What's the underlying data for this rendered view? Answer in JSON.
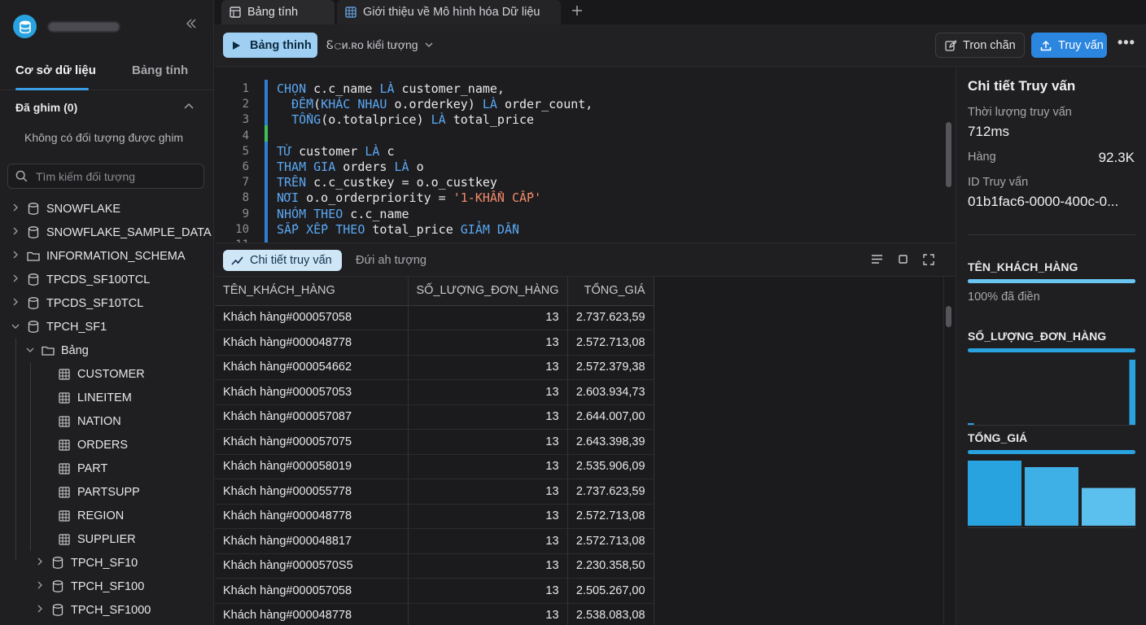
{
  "sidebar": {
    "tabs": [
      "Cơ sở dữ liệu",
      "Bảng tính"
    ],
    "pinned_title": "Đã ghim (0)",
    "no_pinned": "Không có đối tượng được ghim",
    "search_placeholder": "Tìm kiếm đối tượng",
    "databases": [
      "SNOWFLAKE",
      "SNOWFLAKE_SAMPLE_DATA",
      "INFORMATION_SCHEMA",
      "TPCDS_SF100TCL",
      "TPCDS_SF10TCL",
      "TPCH_SF1"
    ],
    "folder": "Bảng",
    "tables": [
      "CUSTOMER",
      "LINEITEM",
      "NATION",
      "ORDERS",
      "PART",
      "PARTSUPP",
      "REGION",
      "SUPPLIER"
    ],
    "schemas": [
      "TPCH_SF10",
      "TPCH_SF100",
      "TPCH_SF1000"
    ]
  },
  "tabs": [
    "Bảng tính",
    "Giới thiệu về Mô hình hóa Dữ liệu"
  ],
  "toolbar": {
    "run_label": "Bảng thinh",
    "context_label": "Ꮛ𝚌ᴎ.ʀo kiểi tượng",
    "format_label": "Tron chãn",
    "query_label": "Truy vấn",
    "more_label": "•••"
  },
  "editor": {
    "line_numbers": [
      "1",
      "2",
      "3",
      "4",
      "5",
      "6",
      "7",
      "8",
      "9",
      "10",
      "11"
    ],
    "lines": [
      [
        {
          "t": "CHỌN",
          "k": "kw"
        },
        {
          "t": " c.c_name "
        },
        {
          "t": "LÀ",
          "k": "kw"
        },
        {
          "t": " customer_name,"
        }
      ],
      [
        {
          "t": "  "
        },
        {
          "t": "ĐẾM",
          "k": "kw"
        },
        {
          "t": "("
        },
        {
          "t": "KHÁC NHAU",
          "k": "kw"
        },
        {
          "t": " o.orderkey) "
        },
        {
          "t": "LÀ",
          "k": "kw"
        },
        {
          "t": " order_count,"
        }
      ],
      [
        {
          "t": "  "
        },
        {
          "t": "TỔNG",
          "k": "kw"
        },
        {
          "t": "(o.totalprice) "
        },
        {
          "t": "LÀ",
          "k": "kw"
        },
        {
          "t": " total_price"
        }
      ],
      [
        {
          "t": ""
        }
      ],
      [
        {
          "t": "TỪ",
          "k": "kw"
        },
        {
          "t": " customer "
        },
        {
          "t": "LÀ",
          "k": "kw"
        },
        {
          "t": " c"
        }
      ],
      [
        {
          "t": "THAM GIA",
          "k": "kw"
        },
        {
          "t": " orders "
        },
        {
          "t": "LÀ",
          "k": "kw"
        },
        {
          "t": " o"
        }
      ],
      [
        {
          "t": "TRÊN",
          "k": "kw"
        },
        {
          "t": " c.c_custkey = o.o_custkey"
        }
      ],
      [
        {
          "t": "NƠI",
          "k": "kw"
        },
        {
          "t": " o.o_orderpriority = "
        },
        {
          "t": "'1-KHẨN CẤP'",
          "k": "str"
        }
      ],
      [
        {
          "t": "NHÓM THEO",
          "k": "kw"
        },
        {
          "t": " c.c_name"
        }
      ],
      [
        {
          "t": "SẮP XẾP THEO",
          "k": "kw"
        },
        {
          "t": " total_price "
        },
        {
          "t": "GIẢM DẦN",
          "k": "kw"
        }
      ]
    ]
  },
  "results": {
    "tabs": [
      "Chi tiết truy vấn",
      "Đứi ah tượng"
    ],
    "columns": [
      "TÊN_KHÁCH_HÀNG",
      "SỐ_LƯỢNG_ĐƠN_HÀNG",
      "TỔNG_GIÁ"
    ],
    "rows": [
      [
        "Khách hàng#000057058",
        "13",
        "2.737.623,59"
      ],
      [
        "Khách hàng#000048778",
        "13",
        "2.572.713,08"
      ],
      [
        "Khách hàng#000054662",
        "13",
        "2.572.379,38"
      ],
      [
        "Khách hàng#000057053",
        "13",
        "2.603.934,73"
      ],
      [
        "Khách hàng#000057087",
        "13",
        "2.644.007,00"
      ],
      [
        "Khách hàng#000057075",
        "13",
        "2.643.398,39"
      ],
      [
        "Khách hàng#000058019",
        "13",
        "2.535.906,09"
      ],
      [
        "Khách hàng#000055778",
        "13",
        "2.737.623,59"
      ],
      [
        "Khách hàng#000048778",
        "13",
        "2.572.713,08"
      ],
      [
        "Khách hàng#000048817",
        "13",
        "2.572.713,08"
      ],
      [
        "Khách hàng#0000570S5",
        "13",
        "2.230.358,50"
      ],
      [
        "Khách hàng#000057058",
        "13",
        "2.505.267,00"
      ],
      [
        "Khách hàng#000048778",
        "13",
        "2.538.083,08"
      ]
    ]
  },
  "details": {
    "title": "Chi tiết Truy vấn",
    "duration_label": "Thời lượng truy vấn",
    "duration_value": "712ms",
    "rows_label": "Hàng",
    "rows_value": "92.3K",
    "query_id_label": "ID Truy vấn",
    "query_id_value": "01b1fac6-0000-400c-0...",
    "col1_name": "TÊN_KHÁCH_HÀNG",
    "col1_filled": "100% đã điền",
    "col1_fill_fraction": 1.0,
    "col2_name": "SỐ_LƯỢNG_ĐƠN_HÀNG",
    "col2_histogram": [
      0.02,
      0,
      0,
      0,
      0,
      0,
      0,
      0,
      0,
      0,
      0,
      0,
      0,
      0,
      0,
      0,
      0,
      0,
      0,
      1.0
    ],
    "col3_name": "TỔNG_GIÁ",
    "col3_histogram": [
      1.0,
      0.9,
      0.58
    ],
    "accent": "#29a3e0"
  }
}
